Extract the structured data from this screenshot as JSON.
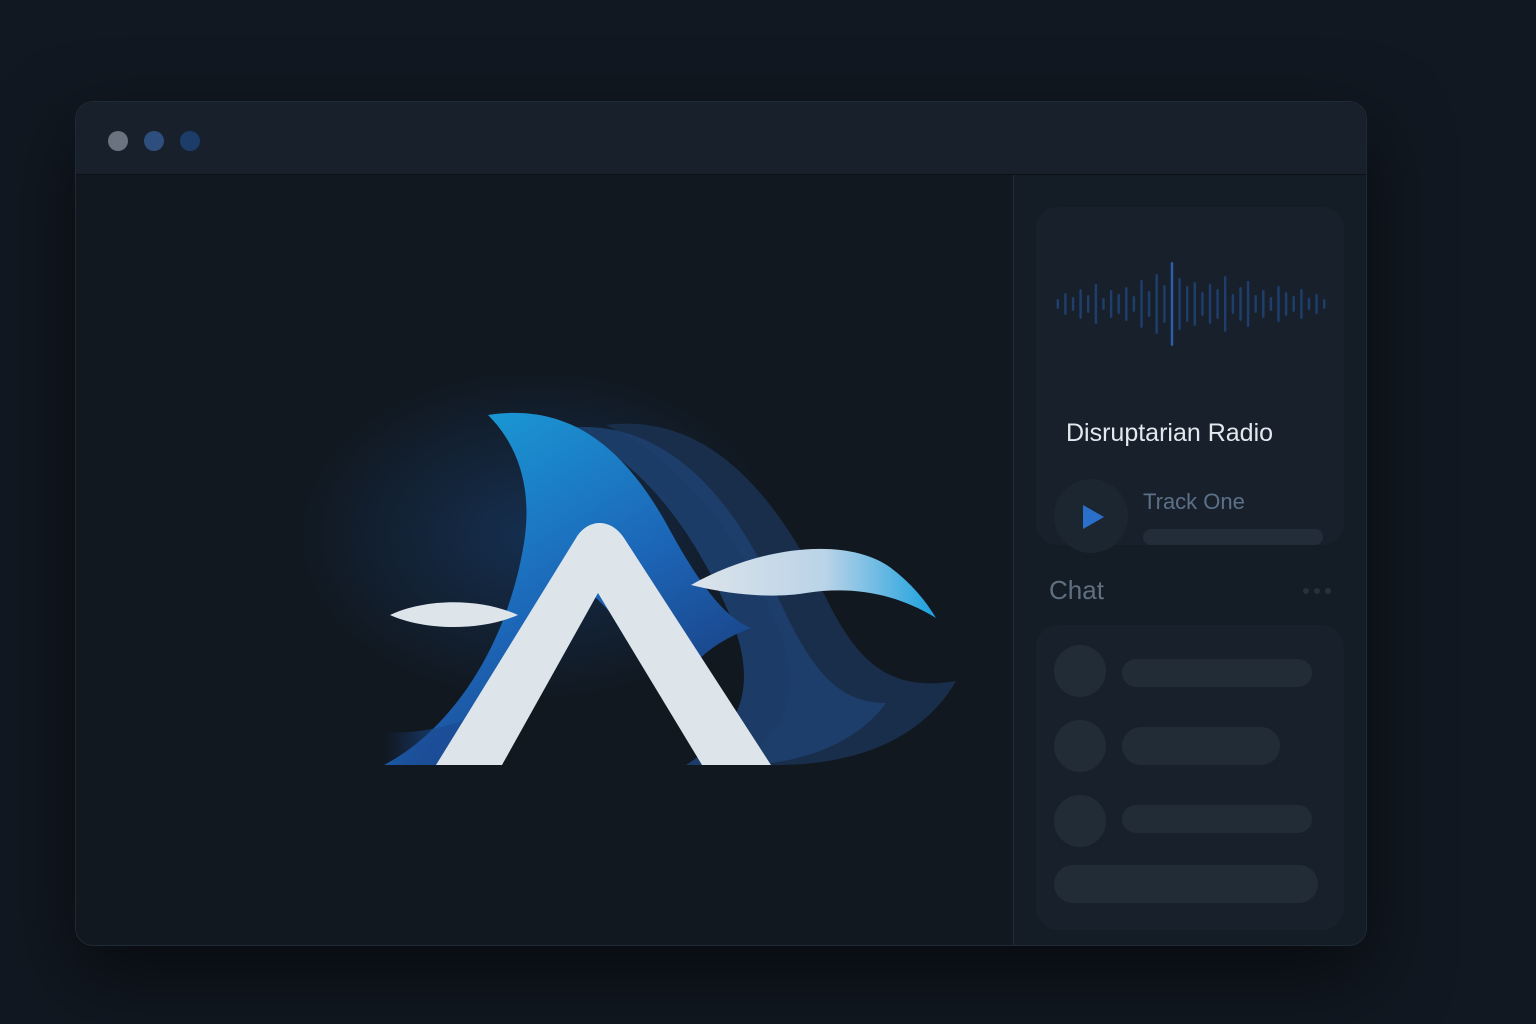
{
  "window": {
    "controls": [
      "close",
      "minimize",
      "zoom"
    ]
  },
  "brand": {
    "logo_icon": "wave-fin-logo",
    "colors": {
      "primary": "#1a94d6",
      "secondary": "#1d4f91",
      "light": "#dde4ea"
    }
  },
  "player": {
    "station": "Disruptarian Radio",
    "track": "Track One",
    "play_icon": "play-icon",
    "waveform_icon": "waveform-icon",
    "accent": "#2a6fc9",
    "progress": 0
  },
  "chat": {
    "title": "Chat",
    "more_icon": "more-dots-icon"
  }
}
